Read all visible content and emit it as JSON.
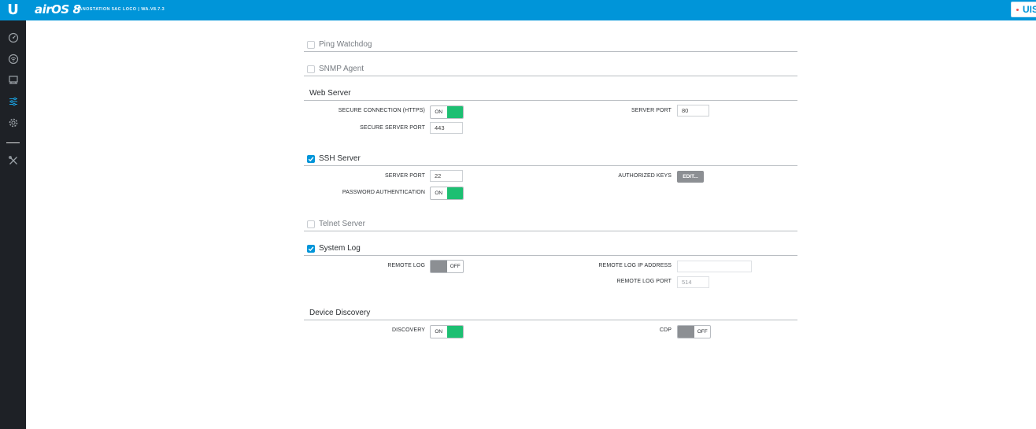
{
  "header": {
    "logo_letter": "U",
    "product_name": "airOS 8",
    "device_info": "NANOSTATION 5AC LOCO | WA.V8.7.3",
    "uisp_label": "UIS"
  },
  "sidebar": {
    "items": [
      {
        "icon": "dashboard-icon"
      },
      {
        "icon": "wireless-icon"
      },
      {
        "icon": "network-icon"
      },
      {
        "icon": "services-icon"
      },
      {
        "icon": "system-icon"
      },
      {
        "icon": "tools-icon"
      }
    ]
  },
  "sections": {
    "ping_watchdog": {
      "label": "Ping Watchdog",
      "checked": false
    },
    "snmp_agent": {
      "label": "SNMP Agent",
      "checked": false
    },
    "web_server": {
      "title": "Web Server",
      "secure_connection_label": "SECURE CONNECTION (HTTPS)",
      "secure_connection_value": "ON",
      "server_port_label": "SERVER PORT",
      "server_port_value": "80",
      "secure_server_port_label": "SECURE SERVER PORT",
      "secure_server_port_value": "443"
    },
    "ssh_server": {
      "label": "SSH Server",
      "checked": true,
      "server_port_label": "SERVER PORT",
      "server_port_value": "22",
      "authorized_keys_label": "AUTHORIZED KEYS",
      "edit_button": "EDIT...",
      "password_auth_label": "PASSWORD AUTHENTICATION",
      "password_auth_value": "ON"
    },
    "telnet_server": {
      "label": "Telnet Server",
      "checked": false
    },
    "system_log": {
      "label": "System Log",
      "checked": true,
      "remote_log_label": "REMOTE LOG",
      "remote_log_value": "OFF",
      "remote_log_ip_label": "REMOTE LOG IP ADDRESS",
      "remote_log_ip_value": "",
      "remote_log_port_label": "REMOTE LOG PORT",
      "remote_log_port_value": "514"
    },
    "device_discovery": {
      "title": "Device Discovery",
      "discovery_label": "DISCOVERY",
      "discovery_value": "ON",
      "cdp_label": "CDP",
      "cdp_value": "OFF"
    }
  },
  "colors": {
    "header_blue": "#0095d9",
    "sidebar_dark": "#1e2126",
    "toggle_on_green": "#1dbf72",
    "toggle_off_gray": "#8c8f93"
  }
}
